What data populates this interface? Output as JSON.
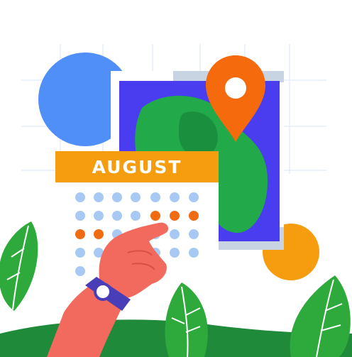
{
  "calendar": {
    "month_label": "AUGUST",
    "highlighted_day_count": 5
  },
  "colors": {
    "blue_circle": "#4f8ff7",
    "map_panel": "#4a3df0",
    "map_land": "#21a94a",
    "pin": "#f46a0c",
    "banner": "#f59c0f",
    "dot_default": "#a9c9f5",
    "dot_highlight": "#ef6c12",
    "orange_circle": "#f59c0f",
    "hand_skin": "#f26a5e",
    "watch_band": "#4a3db8",
    "leaf_green": "#2eaa3c",
    "ground_green": "#1f8a3a"
  },
  "icons": [
    "location-pin-icon",
    "watch-icon"
  ]
}
